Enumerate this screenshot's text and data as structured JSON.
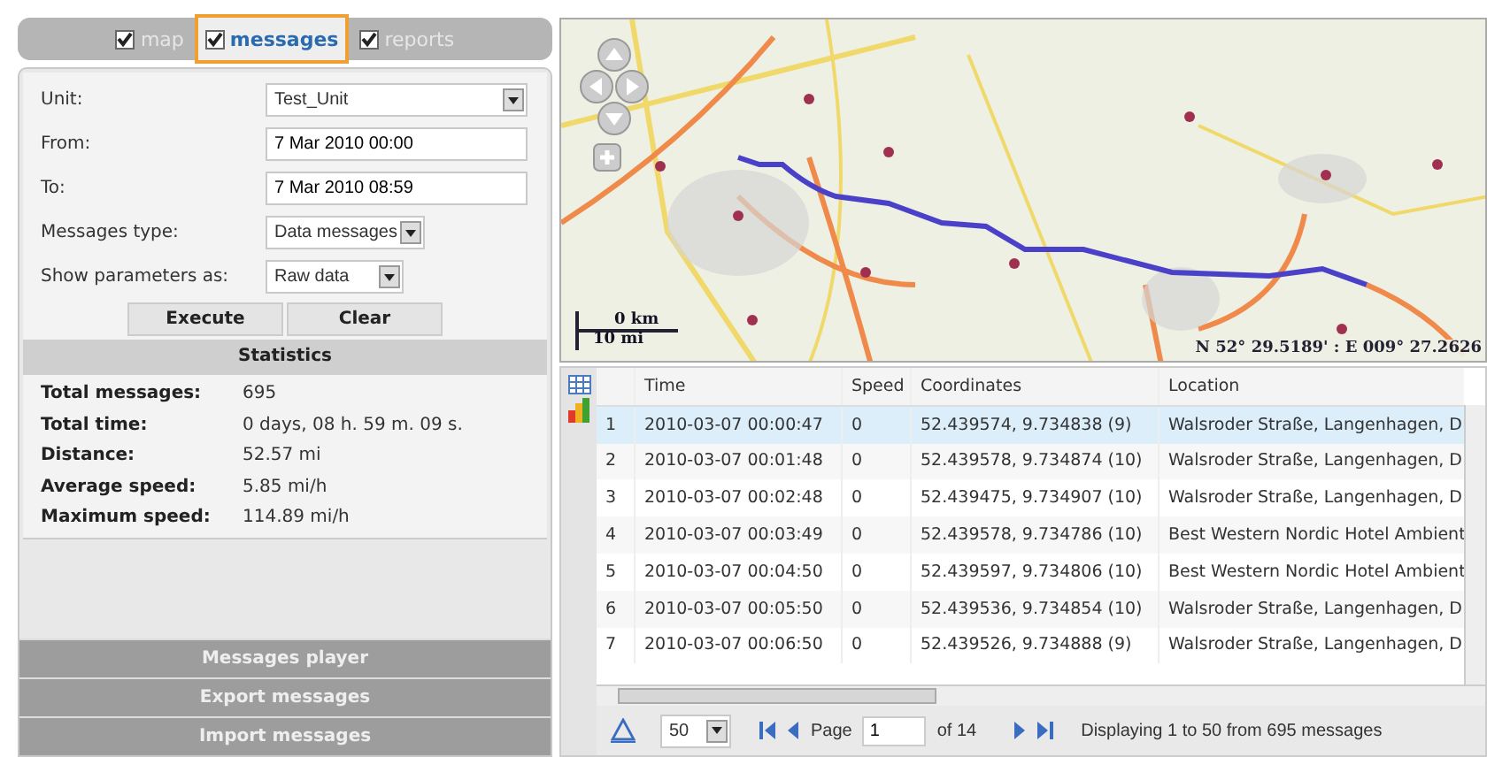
{
  "tabs": [
    {
      "label": "map",
      "checked": true,
      "selected": false
    },
    {
      "label": "messages",
      "checked": true,
      "selected": true
    },
    {
      "label": "reports",
      "checked": true,
      "selected": false
    }
  ],
  "form": {
    "fields": [
      {
        "kind": "select",
        "label": "Unit:",
        "value": "Test_Unit"
      },
      {
        "kind": "text",
        "label": "From:",
        "value": "7 Mar 2010 00:00"
      },
      {
        "kind": "text",
        "label": "To:",
        "value": "7 Mar 2010 08:59"
      },
      {
        "kind": "select",
        "label": "Messages type:",
        "value": "Data messages"
      },
      {
        "kind": "select",
        "label": "Show parameters as:",
        "value": "Raw data"
      }
    ],
    "buttons": [
      "Execute",
      "Clear"
    ]
  },
  "statistics": {
    "title": "Statistics",
    "rows": [
      {
        "label": "Total messages:",
        "value": "695"
      },
      {
        "label": "Total time:",
        "value": "0 days, 08 h. 59 m. 09 s."
      },
      {
        "label": "Distance:",
        "value": "52.57 mi"
      },
      {
        "label": "Average speed:",
        "value": "5.85 mi/h"
      },
      {
        "label": "Maximum speed:",
        "value": "114.89 mi/h"
      }
    ]
  },
  "accordion": [
    "Messages player",
    "Export messages",
    "Import messages"
  ],
  "map": {
    "scale_km": "0 km",
    "scale_mi": "10 mi",
    "coordinates": "N 52° 29.5189' : E 009° 27.2626"
  },
  "table": {
    "columns": [
      "Time",
      "Speed",
      "Coordinates",
      "Location"
    ],
    "rows": [
      {
        "index": "1",
        "selected": true,
        "cells": [
          "2010-03-07 00:00:47",
          "0",
          "52.439574, 9.734838 (9)",
          "Walsroder Straße, Langenhagen, D"
        ]
      },
      {
        "index": "2",
        "selected": false,
        "cells": [
          "2010-03-07 00:01:48",
          "0",
          "52.439578, 9.734874 (10)",
          "Walsroder Straße, Langenhagen, D"
        ]
      },
      {
        "index": "3",
        "selected": false,
        "cells": [
          "2010-03-07 00:02:48",
          "0",
          "52.439475, 9.734907 (10)",
          "Walsroder Straße, Langenhagen, D"
        ]
      },
      {
        "index": "4",
        "selected": false,
        "cells": [
          "2010-03-07 00:03:49",
          "0",
          "52.439578, 9.734786 (10)",
          "Best Western Nordic Hotel Ambient"
        ]
      },
      {
        "index": "5",
        "selected": false,
        "cells": [
          "2010-03-07 00:04:50",
          "0",
          "52.439597, 9.734806 (10)",
          "Best Western Nordic Hotel Ambient"
        ]
      },
      {
        "index": "6",
        "selected": false,
        "cells": [
          "2010-03-07 00:05:50",
          "0",
          "52.439536, 9.734854 (10)",
          "Walsroder Straße, Langenhagen, D"
        ]
      },
      {
        "index": "7",
        "selected": false,
        "cells": [
          "2010-03-07 00:06:50",
          "0",
          "52.439526, 9.734888 (9)",
          "Walsroder Straße, Langenhagen, D"
        ]
      }
    ]
  },
  "pager": {
    "page_size": "50",
    "page_label": "Page",
    "page": "1",
    "page_count": "of 14",
    "summary": "Displaying 1 to 50 from 695 messages"
  }
}
